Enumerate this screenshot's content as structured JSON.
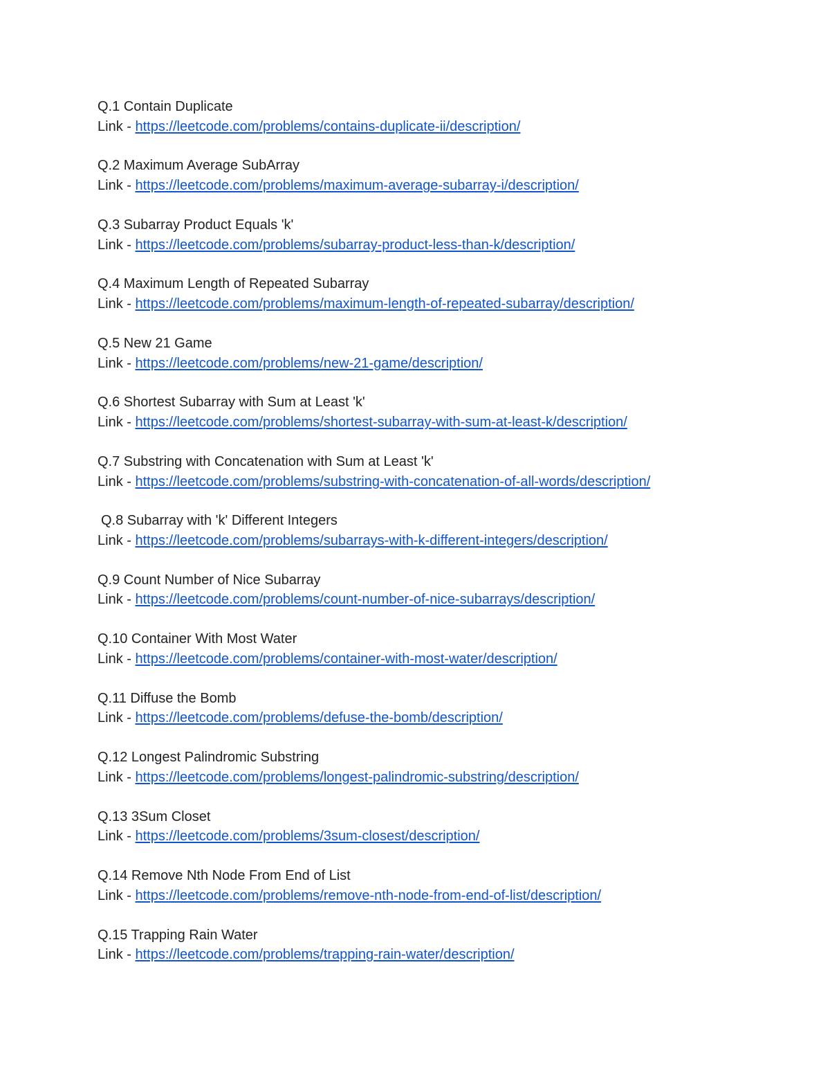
{
  "link_prefix": "Link - ",
  "questions": [
    {
      "title": "Q.1 Contain Duplicate",
      "url": "https://leetcode.com/problems/contains-duplicate-ii/description/"
    },
    {
      "title": "Q.2 Maximum Average SubArray",
      "url": "https://leetcode.com/problems/maximum-average-subarray-i/description/"
    },
    {
      "title": "Q.3 Subarray Product Equals 'k'",
      "url": "https://leetcode.com/problems/subarray-product-less-than-k/description/"
    },
    {
      "title": "Q.4 Maximum Length of Repeated Subarray",
      "url": "https://leetcode.com/problems/maximum-length-of-repeated-subarray/description/"
    },
    {
      "title": "Q.5 New 21 Game",
      "url": "https://leetcode.com/problems/new-21-game/description/"
    },
    {
      "title": "Q.6 Shortest Subarray with Sum at Least 'k'",
      "url": "https://leetcode.com/problems/shortest-subarray-with-sum-at-least-k/description/"
    },
    {
      "title": "Q.7 Substring with Concatenation with Sum at Least 'k'",
      "url": "https://leetcode.com/problems/substring-with-concatenation-of-all-words/description/"
    },
    {
      "title": "Q.8 Subarray with 'k' Different Integers",
      "url": "https://leetcode.com/problems/subarrays-with-k-different-integers/description/"
    },
    {
      "title": "Q.9 Count Number of Nice Subarray",
      "url": "https://leetcode.com/problems/count-number-of-nice-subarrays/description/"
    },
    {
      "title": "Q.10 Container With Most Water",
      "url": "https://leetcode.com/problems/container-with-most-water/description/"
    },
    {
      "title": "Q.11 Diffuse the Bomb",
      "url": "https://leetcode.com/problems/defuse-the-bomb/description/"
    },
    {
      "title": "Q.12 Longest Palindromic Substring",
      "url": "https://leetcode.com/problems/longest-palindromic-substring/description/"
    },
    {
      "title": "Q.13 3Sum Closet",
      "url": "https://leetcode.com/problems/3sum-closest/description/"
    },
    {
      "title": "Q.14 Remove Nth Node From End of List",
      "url": "https://leetcode.com/problems/remove-nth-node-from-end-of-list/description/"
    },
    {
      "title": "Q.15 Trapping Rain Water",
      "url": "https://leetcode.com/problems/trapping-rain-water/description/"
    }
  ],
  "colors": {
    "text": "#222222",
    "link": "#1155cc",
    "background": "#ffffff"
  }
}
